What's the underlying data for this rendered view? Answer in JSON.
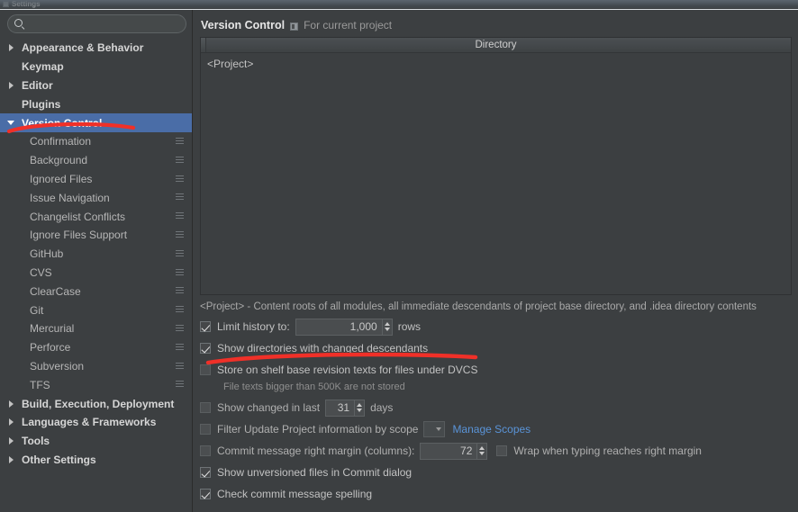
{
  "window": {
    "title": "Settings"
  },
  "search": {
    "value": "",
    "placeholder": ""
  },
  "sidebar": {
    "items": [
      {
        "label": "Appearance & Behavior",
        "level": "top",
        "arrow": "collapsed",
        "selected": false,
        "config_icon": false
      },
      {
        "label": "Keymap",
        "level": "top",
        "arrow": "none",
        "selected": false,
        "config_icon": false
      },
      {
        "label": "Editor",
        "level": "top",
        "arrow": "collapsed",
        "selected": false,
        "config_icon": false
      },
      {
        "label": "Plugins",
        "level": "top",
        "arrow": "none",
        "selected": false,
        "config_icon": false
      },
      {
        "label": "Version Control",
        "level": "top",
        "arrow": "expanded",
        "selected": true,
        "config_icon": false
      },
      {
        "label": "Confirmation",
        "level": "child",
        "arrow": "none",
        "selected": false,
        "config_icon": true
      },
      {
        "label": "Background",
        "level": "child",
        "arrow": "none",
        "selected": false,
        "config_icon": true
      },
      {
        "label": "Ignored Files",
        "level": "child",
        "arrow": "none",
        "selected": false,
        "config_icon": true
      },
      {
        "label": "Issue Navigation",
        "level": "child",
        "arrow": "none",
        "selected": false,
        "config_icon": true
      },
      {
        "label": "Changelist Conflicts",
        "level": "child",
        "arrow": "none",
        "selected": false,
        "config_icon": true
      },
      {
        "label": "Ignore Files Support",
        "level": "child",
        "arrow": "none",
        "selected": false,
        "config_icon": true
      },
      {
        "label": "GitHub",
        "level": "child",
        "arrow": "none",
        "selected": false,
        "config_icon": true
      },
      {
        "label": "CVS",
        "level": "child",
        "arrow": "none",
        "selected": false,
        "config_icon": true
      },
      {
        "label": "ClearCase",
        "level": "child",
        "arrow": "none",
        "selected": false,
        "config_icon": true
      },
      {
        "label": "Git",
        "level": "child",
        "arrow": "none",
        "selected": false,
        "config_icon": true
      },
      {
        "label": "Mercurial",
        "level": "child",
        "arrow": "none",
        "selected": false,
        "config_icon": true
      },
      {
        "label": "Perforce",
        "level": "child",
        "arrow": "none",
        "selected": false,
        "config_icon": true
      },
      {
        "label": "Subversion",
        "level": "child",
        "arrow": "none",
        "selected": false,
        "config_icon": true
      },
      {
        "label": "TFS",
        "level": "child",
        "arrow": "none",
        "selected": false,
        "config_icon": true
      },
      {
        "label": "Build, Execution, Deployment",
        "level": "top",
        "arrow": "collapsed",
        "selected": false,
        "config_icon": false
      },
      {
        "label": "Languages & Frameworks",
        "level": "top",
        "arrow": "collapsed",
        "selected": false,
        "config_icon": false
      },
      {
        "label": "Tools",
        "level": "top",
        "arrow": "collapsed",
        "selected": false,
        "config_icon": false
      },
      {
        "label": "Other Settings",
        "level": "top",
        "arrow": "collapsed",
        "selected": false,
        "config_icon": false
      }
    ]
  },
  "page": {
    "title": "Version Control",
    "scope_label": "For current project",
    "table": {
      "column_header": "Directory",
      "rows": [
        "<Project>"
      ]
    },
    "hint": "<Project> - Content roots of all modules, all immediate descendants of project base directory, and .idea directory contents",
    "options": {
      "limit_history_label": "Limit history to:",
      "limit_history_value": "1,000",
      "limit_history_suffix": "rows",
      "show_directories_label": "Show directories with changed descendants",
      "store_shelf_label": "Store on shelf base revision texts for files under DVCS",
      "store_shelf_note": "File texts bigger than 500K are not stored",
      "show_changed_label": "Show changed in last",
      "show_changed_value": "31",
      "show_changed_suffix": "days",
      "filter_scope_label": "Filter Update Project information by scope",
      "manage_scopes_link": "Manage Scopes",
      "commit_margin_label": "Commit message right margin (columns):",
      "commit_margin_value": "72",
      "wrap_typing_label": "Wrap when typing reaches right margin",
      "show_unversioned_label": "Show unversioned files in Commit dialog",
      "check_spelling_label": "Check commit message spelling"
    }
  },
  "colors": {
    "selection": "#4a6da7",
    "link": "#5a94d8",
    "annotation": "#f03028",
    "background": "#3c3f41"
  }
}
